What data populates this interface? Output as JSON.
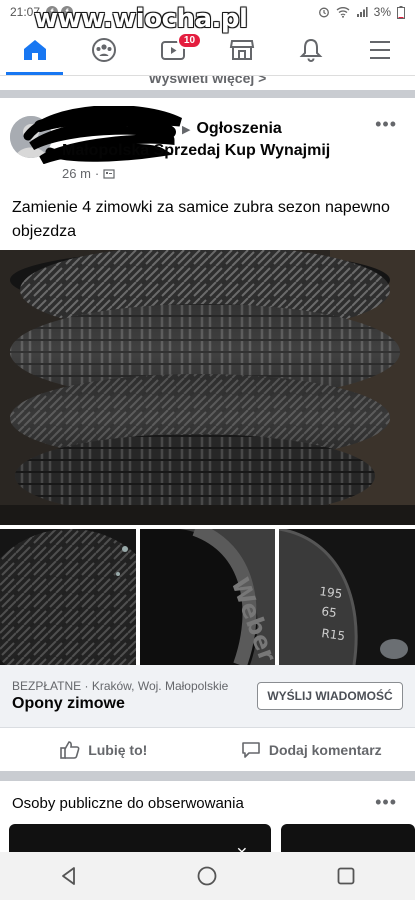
{
  "status_bar": {
    "time": "21:07",
    "battery": "3%",
    "app_icons": [
      "f",
      "f"
    ]
  },
  "watermark": "www.wiocha.pl",
  "nav": {
    "watch_badge": "10",
    "icons": [
      "home-icon",
      "groups-icon",
      "watch-icon",
      "marketplace-icon",
      "notifications-icon",
      "menu-icon"
    ]
  },
  "feed": {
    "see_more": "Wyświetl więcej >"
  },
  "post": {
    "group_name_line1": "Ogłoszenia",
    "group_name_line2": "Małopolska Sprzedaj Kup  Wynajmij",
    "time": "26 m",
    "separator": "·",
    "more": "•••",
    "text": "Zamienie 4 zimowki za samice zubra sezon napewno objezdza",
    "tire_size": [
      "195",
      "65",
      "R15"
    ],
    "tire_brand": "Weber"
  },
  "listing": {
    "price": "BEZPŁATNE",
    "location": "Kraków, Woj. Małopolskie",
    "meta_sep": " · ",
    "title": "Opony zimowe",
    "message_button": "WYŚLIJ WIADOMOŚĆ"
  },
  "actions": {
    "like": "Lubię to!",
    "comment": "Dodaj komentarz"
  },
  "suggestions": {
    "title": "Osoby publiczne do obserwowania",
    "more": "•••",
    "close": "✕"
  },
  "colors": {
    "accent": "#1877f2",
    "badge": "#e41e3f",
    "secondary_text": "#65676b"
  }
}
